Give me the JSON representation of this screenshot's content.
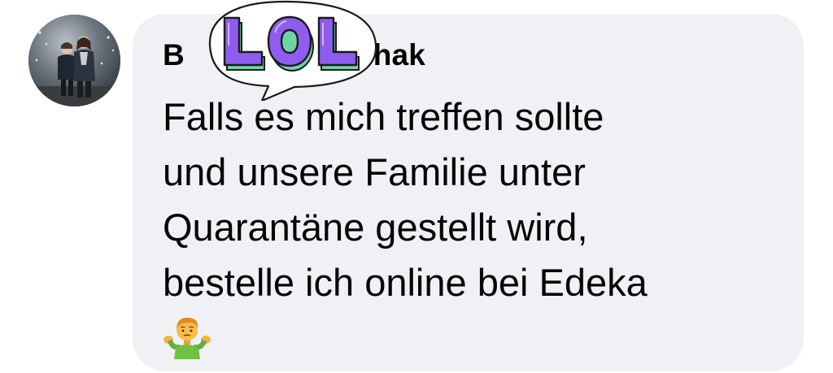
{
  "comment": {
    "author_visible_start": "B",
    "author_visible_end": "chak",
    "message_lines": [
      "Falls es mich treffen sollte",
      "und unsere Familie unter",
      "Quarantäne gestellt wird,",
      "bestelle ich online bei Edeka"
    ],
    "emoji": "person-shrugging"
  },
  "sticker": {
    "text": "LOL",
    "fill_color": "#8f5cf0",
    "shadow_color": "#6fd4a3"
  },
  "colors": {
    "bubble_background": "#f0f1f5",
    "text": "#050505",
    "page_background": "#ffffff"
  }
}
